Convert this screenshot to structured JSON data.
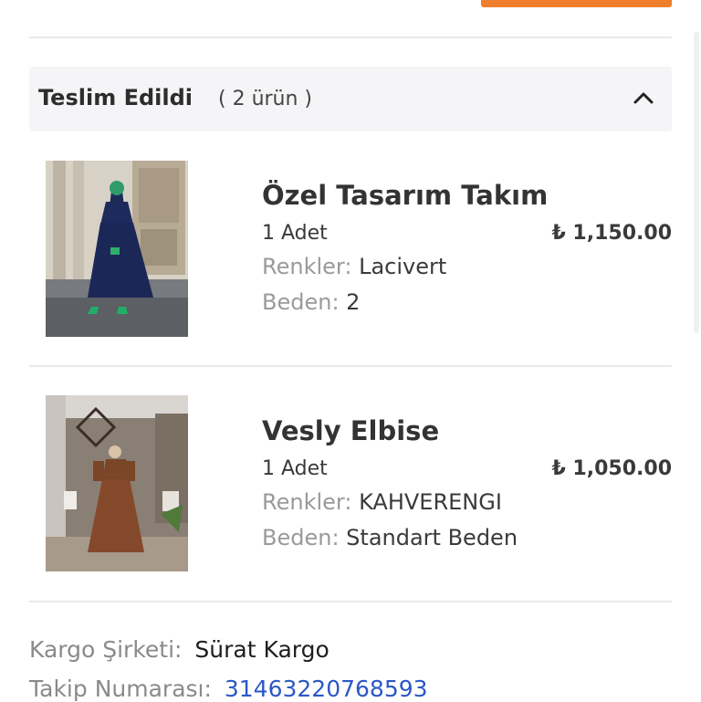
{
  "section": {
    "title": "Teslim Edildi",
    "count": "( 2 ürün )"
  },
  "products": [
    {
      "name": "Özel Tasarım Takım",
      "quantity": "1 Adet",
      "price": "₺ 1,150.00",
      "color_label": "Renkler:",
      "color_value": "Lacivert",
      "size_label": "Beden:",
      "size_value": "2"
    },
    {
      "name": "Vesly Elbise",
      "quantity": "1 Adet",
      "price": "₺ 1,050.00",
      "color_label": "Renkler:",
      "color_value": "KAHVERENGI",
      "size_label": "Beden:",
      "size_value": "Standart Beden"
    }
  ],
  "shipping": {
    "company_label": "Kargo Şirketi:",
    "company_value": "Sürat Kargo",
    "tracking_label": "Takip Numarası:",
    "tracking_value": "31463220768593"
  },
  "colors": {
    "accent": "#f07f2d",
    "link": "#2b58c5",
    "header_bg": "#f5f5f7"
  },
  "icons": {
    "collapse": "chevron-up-icon"
  }
}
